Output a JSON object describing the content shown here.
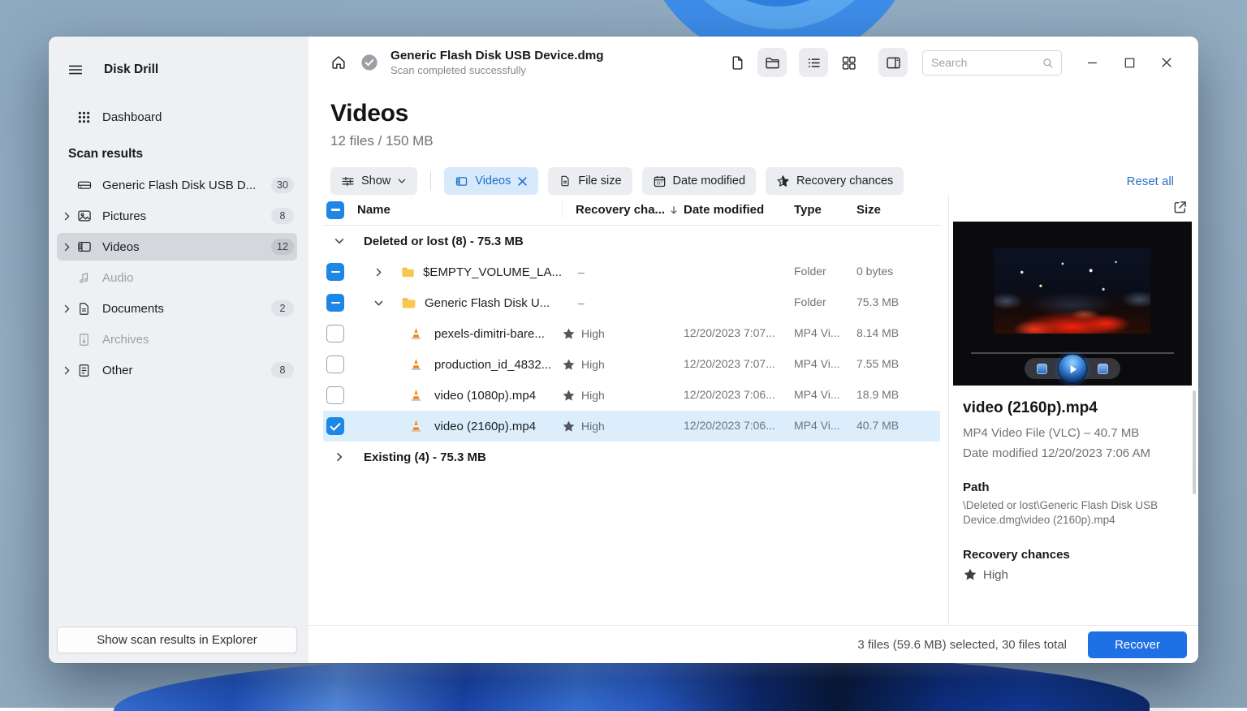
{
  "colors": {
    "accent": "#1e87e5",
    "chip_active_bg": "#d8e9fb",
    "chip_active_fg": "#1b6fc9",
    "selection_bg": "#dceefb",
    "recover_bg": "#1f6fe5"
  },
  "sidebar": {
    "app_title": "Disk Drill",
    "dashboard": "Dashboard",
    "section": "Scan results",
    "items": [
      {
        "label": "Generic Flash Disk USB D...",
        "count": "30"
      },
      {
        "label": "Pictures",
        "count": "8"
      },
      {
        "label": "Videos",
        "count": "12"
      },
      {
        "label": "Audio",
        "count": ""
      },
      {
        "label": "Documents",
        "count": "2"
      },
      {
        "label": "Archives",
        "count": ""
      },
      {
        "label": "Other",
        "count": "8"
      }
    ],
    "bottom_button": "Show scan results in Explorer"
  },
  "header": {
    "title": "Generic Flash Disk USB Device.dmg",
    "subtitle": "Scan completed successfully",
    "search_placeholder": "Search"
  },
  "page": {
    "title": "Videos",
    "subtitle": "12 files / 150 MB",
    "filters": {
      "show": "Show",
      "type_chip": "Videos",
      "file_size": "File size",
      "date_modified": "Date modified",
      "recovery": "Recovery chances",
      "reset": "Reset all"
    }
  },
  "table": {
    "headers": {
      "name": "Name",
      "recovery": "Recovery cha...",
      "date": "Date modified",
      "type": "Type",
      "size": "Size"
    },
    "groups": {
      "deleted": "Deleted or lost (8) - 75.3 MB",
      "existing": "Existing (4) - 75.3 MB"
    },
    "folders": [
      {
        "name": "$EMPTY_VOLUME_LA...",
        "recovery": "–",
        "type": "Folder",
        "size": "0 bytes"
      },
      {
        "name": "Generic Flash Disk U...",
        "recovery": "–",
        "type": "Folder",
        "size": "75.3 MB"
      }
    ],
    "files": [
      {
        "name": "pexels-dimitri-bare...",
        "recovery": "High",
        "date": "12/20/2023 7:07...",
        "type": "MP4 Vi...",
        "size": "8.14 MB"
      },
      {
        "name": "production_id_4832...",
        "recovery": "High",
        "date": "12/20/2023 7:07...",
        "type": "MP4 Vi...",
        "size": "7.55 MB"
      },
      {
        "name": "video (1080p).mp4",
        "recovery": "High",
        "date": "12/20/2023 7:06...",
        "type": "MP4 Vi...",
        "size": "18.9 MB"
      },
      {
        "name": "video (2160p).mp4",
        "recovery": "High",
        "date": "12/20/2023 7:06...",
        "type": "MP4 Vi...",
        "size": "40.7 MB"
      }
    ]
  },
  "preview": {
    "file_name": "video (2160p).mp4",
    "meta": "MP4 Video File (VLC) – 40.7 MB",
    "date": "Date modified 12/20/2023 7:06 AM",
    "path_label": "Path",
    "path": "\\Deleted or lost\\Generic Flash Disk USB Device.dmg\\video (2160p).mp4",
    "recovery_label": "Recovery chances",
    "recovery_value": "High"
  },
  "footer": {
    "status": "3 files (59.6 MB) selected, 30 files total",
    "recover": "Recover"
  }
}
